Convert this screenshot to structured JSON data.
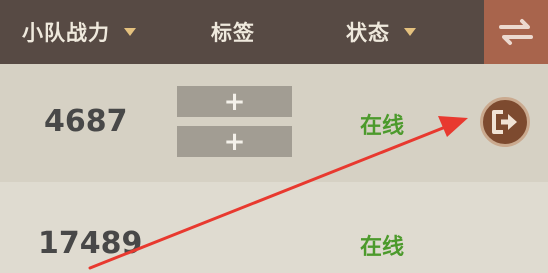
{
  "header": {
    "power_label": "小队战力",
    "tag_label": "标签",
    "status_label": "状态",
    "swap_icon": "swap-arrows-icon",
    "caret_color": "#e4c17e"
  },
  "rows": [
    {
      "power": "4687",
      "tag_slots": [
        "+",
        "+"
      ],
      "status": "在线",
      "action_icon": "leave-team-icon"
    },
    {
      "power": "17489",
      "status": "在线"
    }
  ],
  "colors": {
    "header_bg": "#574a44",
    "swap_bg": "#a8644c",
    "online_green": "#4c9a2c",
    "arrow_red": "#e8392f"
  }
}
